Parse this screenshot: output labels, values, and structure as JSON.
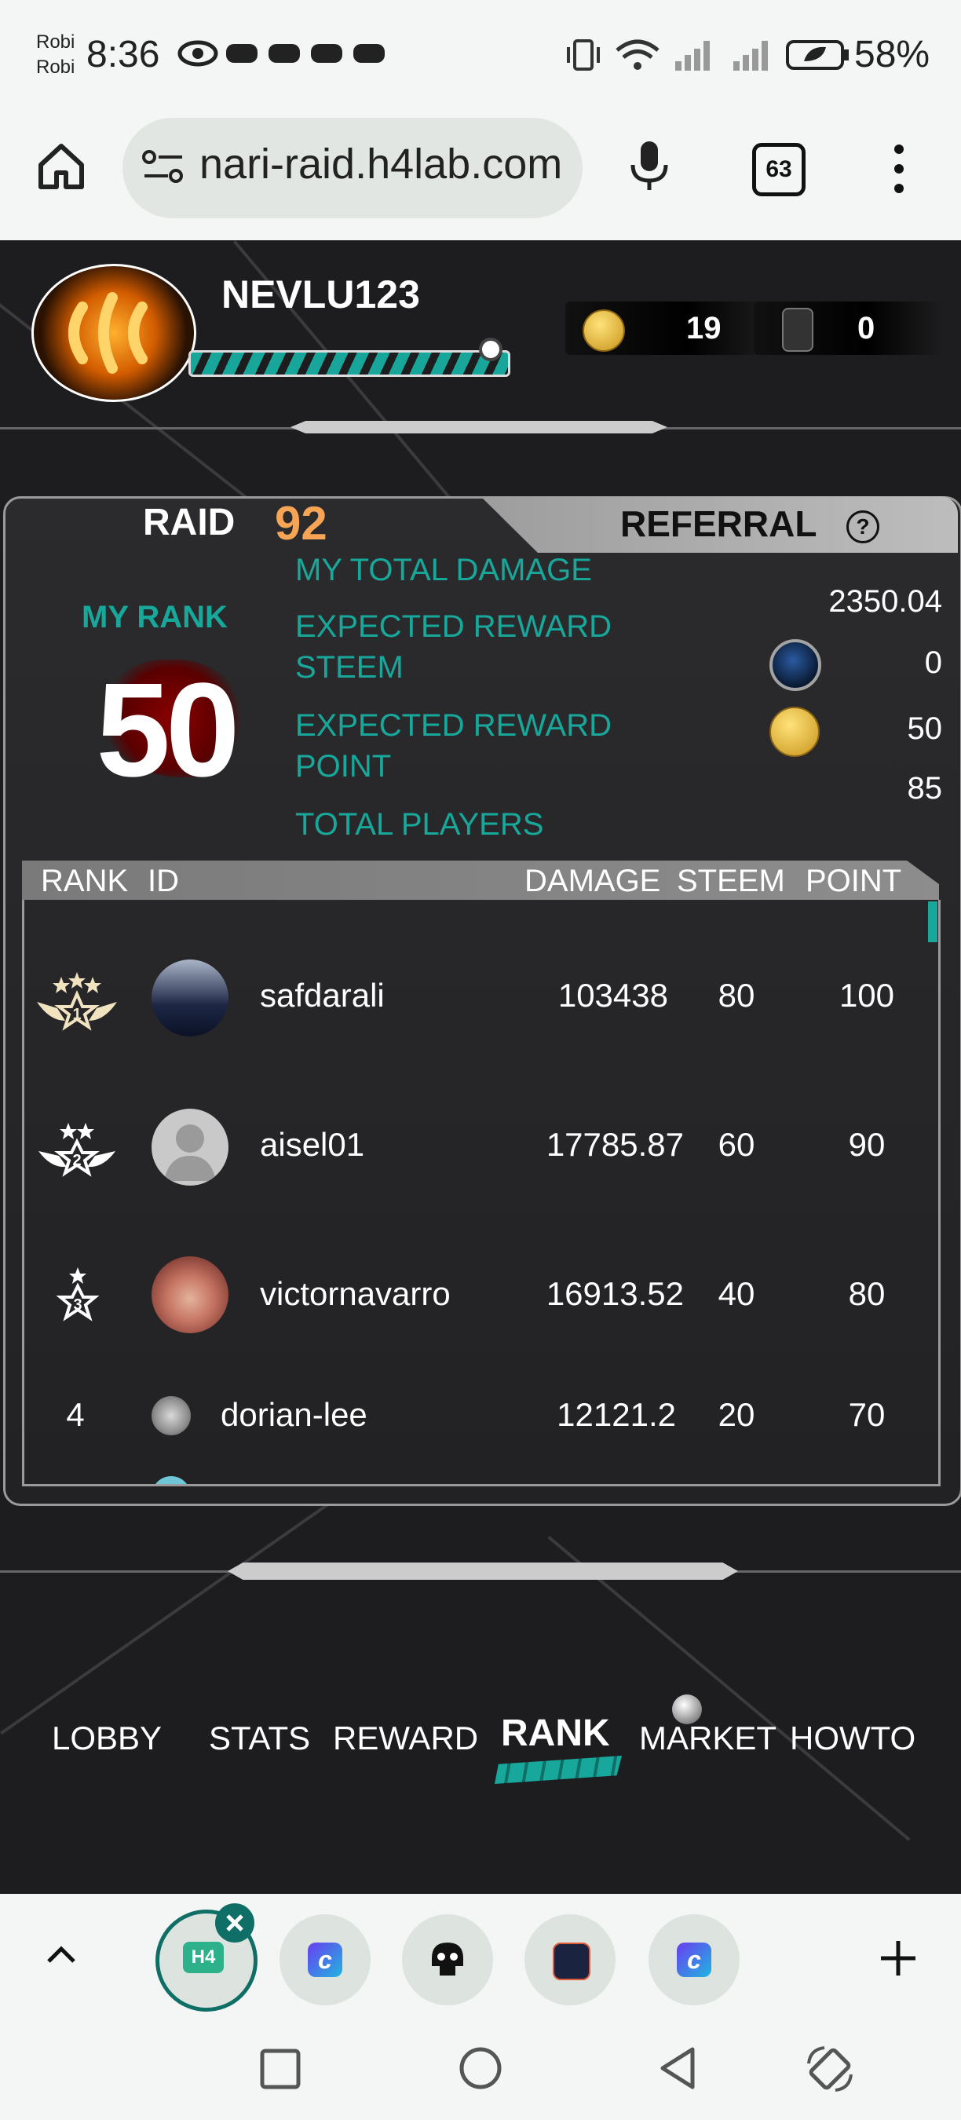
{
  "status_bar": {
    "carrier_1": "Robi",
    "carrier_2": "Robi",
    "time": "8:36",
    "battery": "58%"
  },
  "browser": {
    "url": "nari-raid.h4lab.com",
    "tab_count": "63"
  },
  "player": {
    "name": "NEVLU123",
    "coins": "19",
    "tickets": "0"
  },
  "raid": {
    "raid_label": "RAID",
    "raid_number": "92",
    "referral_label": "REFERRAL",
    "help_icon": "?",
    "my_rank_label": "MY RANK",
    "my_rank": "50",
    "my_total_damage_label": "MY TOTAL DAMAGE",
    "my_total_damage": "2350.04",
    "expected_reward_steem_label_1": "EXPECTED REWARD",
    "expected_reward_steem_label_2": "STEEM",
    "expected_reward_steem": "0",
    "expected_reward_point_label_1": "EXPECTED REWARD",
    "expected_reward_point_label_2": "POINT",
    "expected_reward_point": "50",
    "total_players_label": "TOTAL PLAYERS",
    "total_players": "85"
  },
  "table": {
    "headers": {
      "rank": "RANK",
      "id": "ID",
      "damage": "DAMAGE",
      "steem": "STEEM",
      "point": "POINT"
    },
    "rows": [
      {
        "rank": "1",
        "id": "safdarali",
        "damage": "103438",
        "steem": "80",
        "point": "100"
      },
      {
        "rank": "2",
        "id": "aisel01",
        "damage": "17785.87",
        "steem": "60",
        "point": "90"
      },
      {
        "rank": "3",
        "id": "victornavarro",
        "damage": "16913.52",
        "steem": "40",
        "point": "80"
      },
      {
        "rank": "4",
        "id": "dorian-lee",
        "damage": "12121.2",
        "steem": "20",
        "point": "70"
      }
    ]
  },
  "game_nav": {
    "lobby": "LOBBY",
    "stats": "STATS",
    "reward": "REWARD",
    "rank": "RANK",
    "market": "MARKET",
    "howto": "HOWTO",
    "active": "RANK"
  },
  "tab_bar": {
    "active_tab_label": "H4"
  },
  "colors": {
    "accent_teal": "#17a79b",
    "raid_orange": "#f6a455",
    "background": "#1d1d1f"
  }
}
